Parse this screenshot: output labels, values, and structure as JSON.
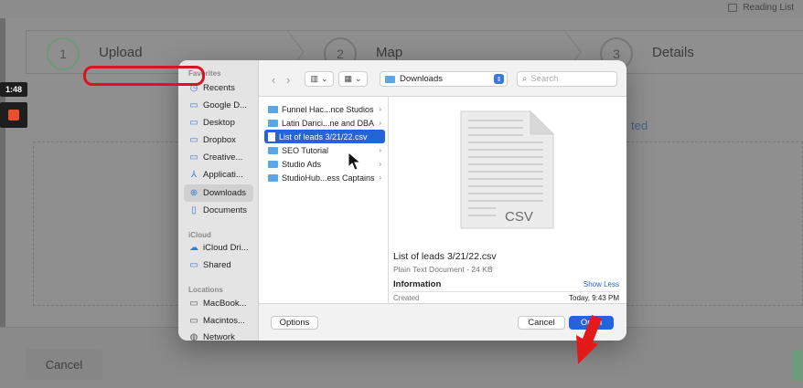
{
  "background": {
    "reading_list": "Reading List",
    "steps": [
      {
        "number": "1",
        "label": "Upload"
      },
      {
        "number": "2",
        "label": "Map"
      },
      {
        "number": "3",
        "label": "Details"
      }
    ],
    "uploaded_link": "ted",
    "cancel_label": "Cancel"
  },
  "recorder": {
    "timer": "1:48"
  },
  "dialog": {
    "sidebar": {
      "favorites_header": "Favorites",
      "favorites": [
        "Recents",
        "Google D...",
        "Desktop",
        "Dropbox",
        "Creative...",
        "Applicati...",
        "Downloads",
        "Documents"
      ],
      "icloud_header": "iCloud",
      "icloud": [
        "iCloud Dri...",
        "Shared"
      ],
      "locations_header": "Locations",
      "locations": [
        "MacBook...",
        "Macintos...",
        "Network"
      ]
    },
    "toolbar": {
      "location": "Downloads",
      "search_placeholder": "Search"
    },
    "files": [
      {
        "name": "Funnel Hac...nce Studios",
        "type": "folder"
      },
      {
        "name": "Latin Danci...ne and DBA",
        "type": "folder"
      },
      {
        "name": "List of leads 3/21/22.csv",
        "type": "file",
        "selected": true
      },
      {
        "name": "SEO Tutorial",
        "type": "folder"
      },
      {
        "name": "Studio Ads",
        "type": "folder"
      },
      {
        "name": "StudioHub...ess Captains",
        "type": "folder"
      }
    ],
    "preview": {
      "icon_label": "CSV",
      "file_name": "List of leads 3/21/22.csv",
      "kind": "Plain Text Document - 24 KB",
      "info_header": "Information",
      "show_less": "Show Less",
      "created_label": "Created",
      "created_value": "Today, 9:43 PM"
    },
    "buttons": {
      "options": "Options",
      "cancel": "Cancel",
      "open": "Open"
    }
  },
  "colors": {
    "accent": "#2563d9",
    "highlight": "#d3161f",
    "folder": "#5aa7e8",
    "step_active": "#6e9a7b"
  }
}
